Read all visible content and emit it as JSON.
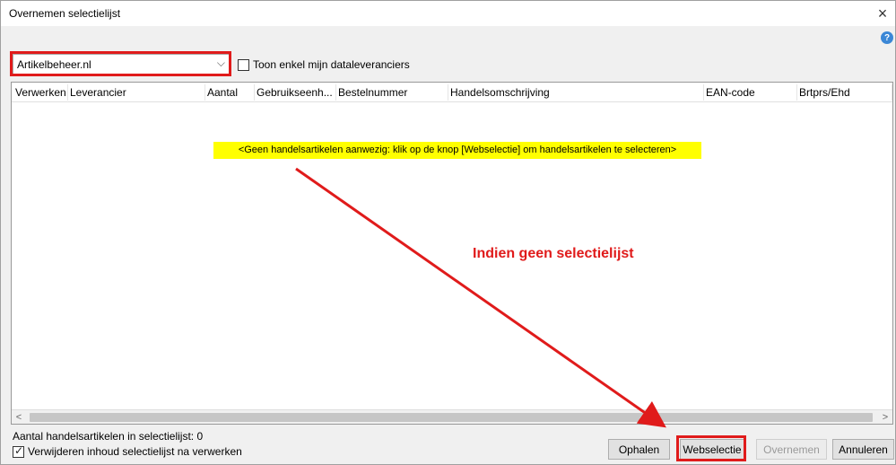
{
  "window": {
    "title": "Overnemen selectielijst",
    "close_label": "×",
    "help_label": "?"
  },
  "toolbar": {
    "source_value": "Artikelbeheer.nl",
    "only_my_suppliers_label": "Toon enkel mijn dataleveranciers",
    "only_my_suppliers_checked": false
  },
  "grid": {
    "columns": [
      "Verwerken",
      "Leverancier",
      "Aantal",
      "Gebruikseenh...",
      "Bestelnummer",
      "Handelsomschrijving",
      "EAN-code",
      "Brtprs/Ehd"
    ],
    "empty_message": "<Geen handelsartikelen aanwezig: klik op de knop [Webselectie] om handelsartikelen te selecteren>",
    "scroll_left": "<",
    "scroll_right": ">"
  },
  "footer": {
    "count_label": "Aantal handelsartikelen in selectielijst: 0",
    "delete_after_processing_label": "Verwijderen inhoud selectielijst na verwerken",
    "delete_after_processing_checked": true
  },
  "buttons": {
    "ophalen": "Ophalen",
    "webselectie": "Webselectie",
    "overnemen": "Overnemen",
    "annuleren": "Annuleren"
  },
  "annotation": {
    "text": "Indien geen selectielijst",
    "color": "#e01b1b"
  },
  "highlight_color": "#ffff00"
}
